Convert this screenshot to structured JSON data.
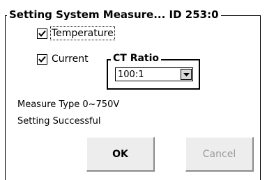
{
  "dialog": {
    "title": "Setting System Measure... ID 253:0"
  },
  "checkboxes": [
    {
      "label": "Temperature",
      "checked": true
    },
    {
      "label": "Current",
      "checked": true
    }
  ],
  "ct_ratio": {
    "title": "CT Ratio",
    "selected": "100:1"
  },
  "status": {
    "measure_type": "Measure Type 0~750V",
    "message": "Setting Successful"
  },
  "buttons": {
    "ok": "OK",
    "cancel": "Cancel"
  },
  "icons": {
    "check": "checkmark-icon",
    "dropdown": "chevron-down-icon"
  }
}
